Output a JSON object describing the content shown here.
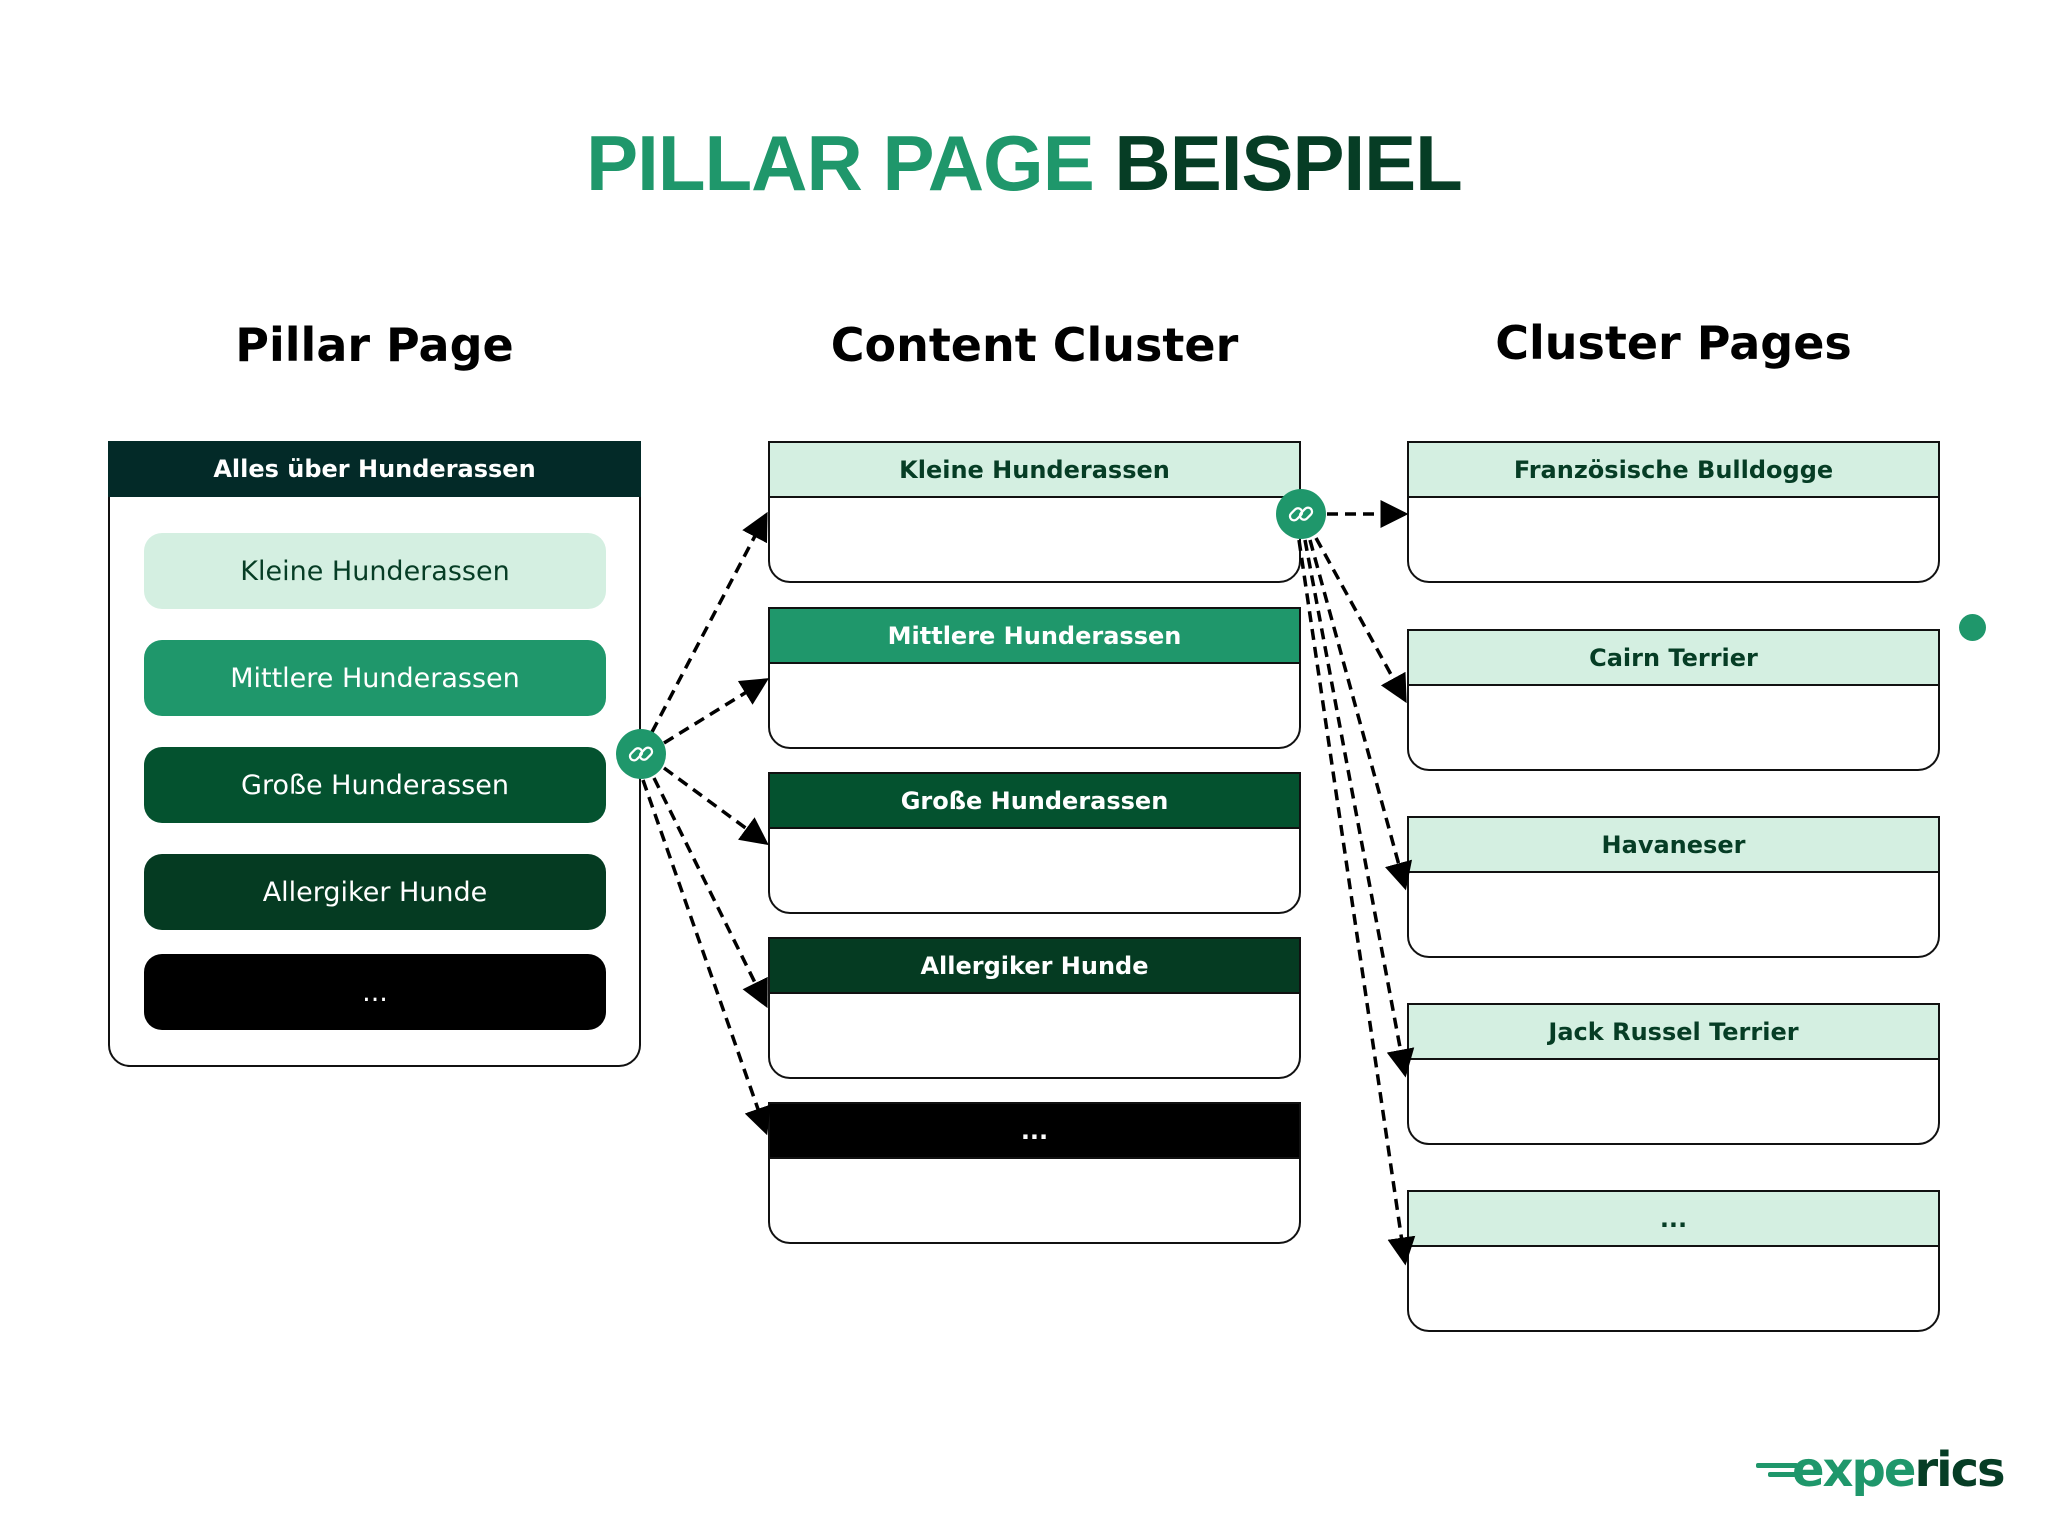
{
  "title": {
    "part1": "PILLAR PAGE",
    "part2": "BEISPIEL"
  },
  "colors": {
    "accent": "#1f976b",
    "dark_green": "#063d25",
    "pillar_header": "#032a28",
    "light_mint": "#d4efe1",
    "medium_green": "#1f976b",
    "forest_green": "#04522f",
    "deep_green": "#053b22",
    "black": "#000000"
  },
  "columns": {
    "pillar": "Pillar Page",
    "cluster": "Content Cluster",
    "pages": "Cluster Pages"
  },
  "pillar_page": {
    "header": "Alles über Hunderassen",
    "items": [
      {
        "label": "Kleine Hunderassen",
        "bg": "#d4efe1",
        "fg": "#063d25"
      },
      {
        "label": "Mittlere Hunderassen",
        "bg": "#1f976b",
        "fg": "#ffffff"
      },
      {
        "label": "Große Hunderassen",
        "bg": "#04522f",
        "fg": "#ffffff"
      },
      {
        "label": "Allergiker Hunde",
        "bg": "#053b22",
        "fg": "#ffffff"
      },
      {
        "label": "...",
        "bg": "#000000",
        "fg": "#ffffff"
      }
    ]
  },
  "content_cluster": [
    {
      "label": "Kleine Hunderassen",
      "bg": "#d4efe1",
      "fg": "#063d25"
    },
    {
      "label": "Mittlere Hunderassen",
      "bg": "#1f976b",
      "fg": "#ffffff"
    },
    {
      "label": "Große Hunderassen",
      "bg": "#04522f",
      "fg": "#ffffff"
    },
    {
      "label": "Allergiker Hunde",
      "bg": "#053b22",
      "fg": "#ffffff"
    },
    {
      "label": "...",
      "bg": "#000000",
      "fg": "#ffffff"
    }
  ],
  "cluster_pages": [
    {
      "label": "Französische Bulldogge"
    },
    {
      "label": "Cairn Terrier"
    },
    {
      "label": "Havaneser"
    },
    {
      "label": "Jack Russel Terrier"
    },
    {
      "label": "..."
    }
  ],
  "icons": {
    "link": "link-chain-icon"
  },
  "logo": {
    "part1": "expe",
    "part2": "rics"
  }
}
